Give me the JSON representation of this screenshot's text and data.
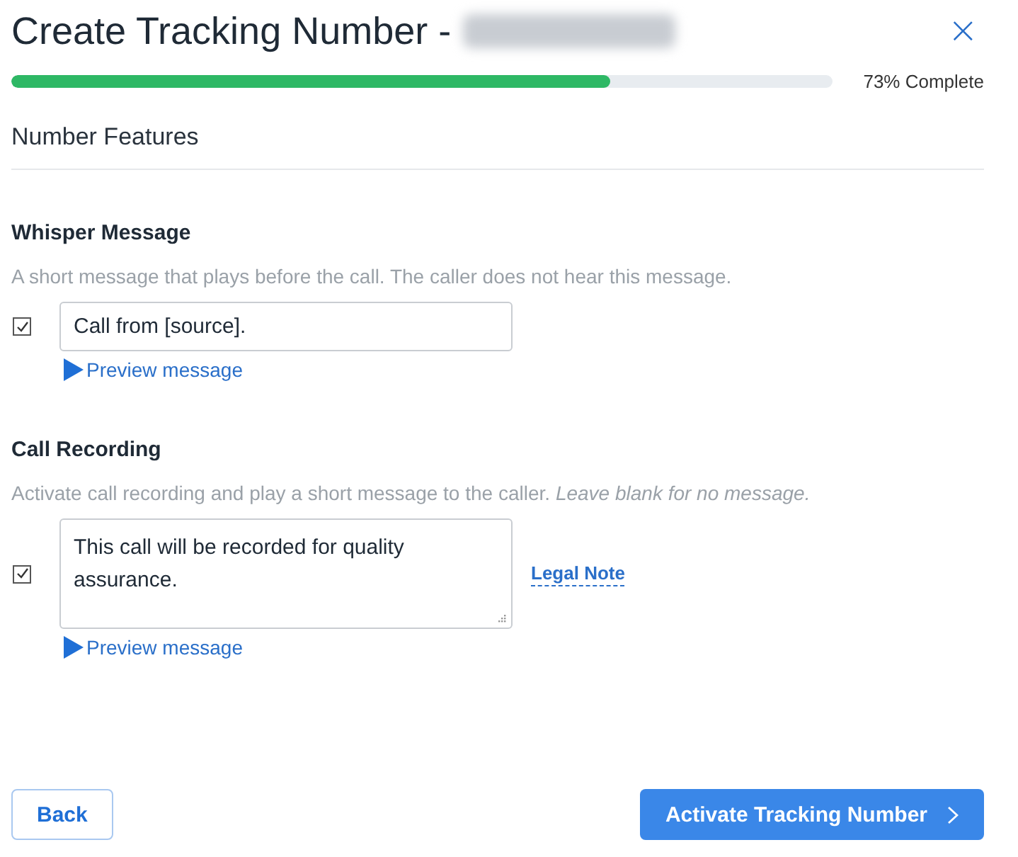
{
  "header": {
    "title": "Create Tracking Number -",
    "name_redacted": true,
    "close": "×"
  },
  "progress": {
    "level": 0.73,
    "reading": "73% Complete"
  },
  "step_title": "Number Features",
  "sections": [
    {
      "kind": "input",
      "heading": "Whisper Message",
      "description": "A short message that plays before the call. The caller does not hear this message.",
      "checked": true,
      "value": "Call from [source].",
      "preview": "Preview message"
    },
    {
      "kind": "textarea",
      "heading": "Call Recording",
      "description": "Activate call recording and play a short message to the caller. *Leave blank for no message.*",
      "checked": true,
      "value": "This call will be recorded for quality assurance.",
      "legal_note": "Legal Note",
      "preview": "Preview message"
    }
  ],
  "buttons": {
    "back": "Back",
    "primary": "Activate Tracking Number"
  }
}
